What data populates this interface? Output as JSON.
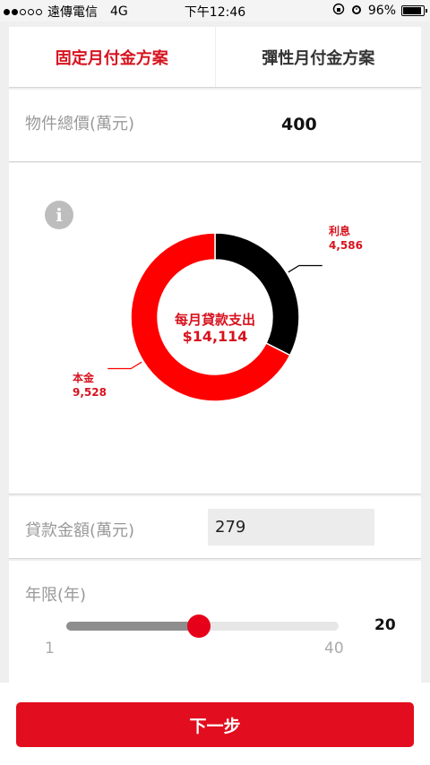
{
  "status_bar": {
    "carrier": "遠傳電信",
    "network": "4G",
    "time": "下午12:46",
    "battery": "96%"
  },
  "tabs": [
    {
      "label": "固定月付金方案",
      "active": true
    },
    {
      "label": "彈性月付金方案",
      "active": false
    }
  ],
  "property_price": {
    "label": "物件總價(萬元)",
    "value": "400"
  },
  "chart": {
    "info_icon_glyph": "i",
    "center_title": "每月貸款支出",
    "center_value": "$14,114"
  },
  "chart_data": {
    "type": "pie",
    "donut": true,
    "slices": [
      {
        "name": "利息",
        "value": 4586,
        "value_label": "4,586",
        "color": "#000000"
      },
      {
        "name": "本金",
        "value": 9528,
        "value_label": "9,528",
        "color": "#ff0000"
      }
    ]
  },
  "loan_amount": {
    "label": "貸款金額(萬元)",
    "value": "279"
  },
  "years": {
    "label": "年限(年)",
    "min_label": "1",
    "max_label": "40",
    "min": 1,
    "max": 40,
    "value": 20,
    "value_label": "20"
  },
  "footer": {
    "next_label": "下一步"
  },
  "colors": {
    "accent": "#e20d1e"
  }
}
